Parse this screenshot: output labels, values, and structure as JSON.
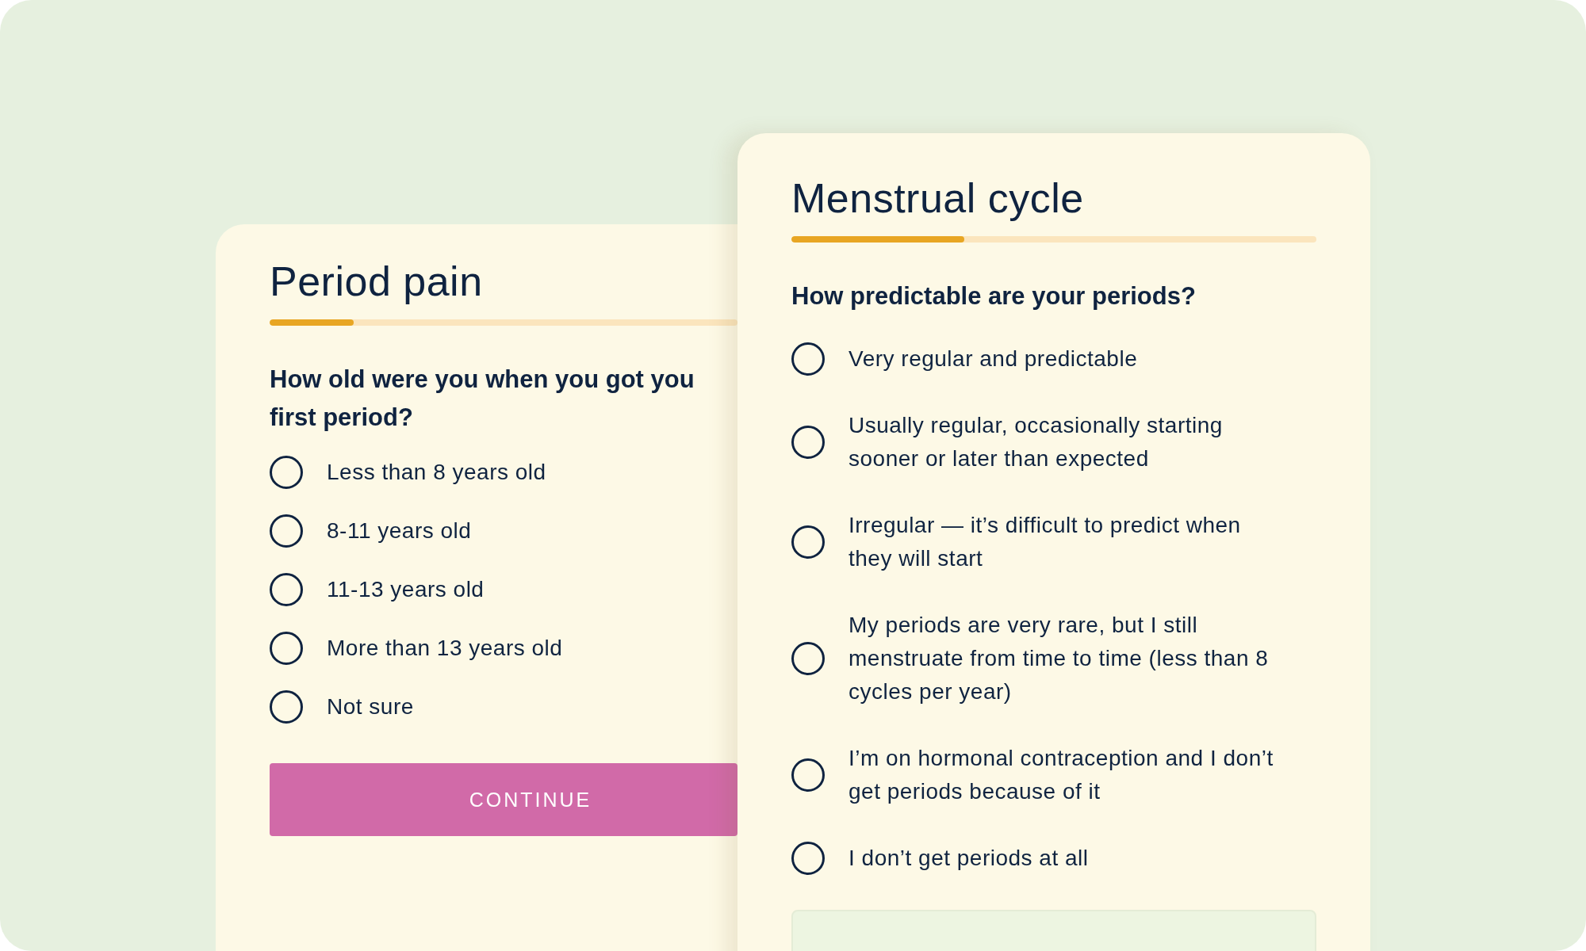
{
  "back_card": {
    "title": "Period pain",
    "progress": {
      "level": 0.18
    },
    "question_lines": [
      "How old were you when you got you",
      "first period?"
    ],
    "options": [
      {
        "label": "Less than 8 years old",
        "selected": false
      },
      {
        "label": "8-11 years old",
        "selected": false
      },
      {
        "label": "11-13 years old",
        "selected": false
      },
      {
        "label": "More than 13 years old",
        "selected": false
      },
      {
        "label": "Not sure",
        "selected": false
      }
    ],
    "button": "CONTINUE"
  },
  "front_card": {
    "title": "Menstrual cycle",
    "progress": {
      "level": 0.33
    },
    "question": "How predictable are your periods?",
    "options": [
      {
        "label": "Very regular and predictable",
        "selected": false
      },
      {
        "label": "Usually regular, occasionally starting sooner or later than expected",
        "selected": false
      },
      {
        "label": "Irregular — it’s difficult to predict when they will start",
        "selected": false
      },
      {
        "label": "My periods are very rare, but I still menstruate from time to time (less than 8 cycles per year)",
        "selected": false
      },
      {
        "label": "I’m on hormonal contraception and I don’t get periods because of it",
        "selected": false
      },
      {
        "label": "I don’t get periods at all",
        "selected": false
      }
    ],
    "note": {
      "kind": "info"
    }
  }
}
